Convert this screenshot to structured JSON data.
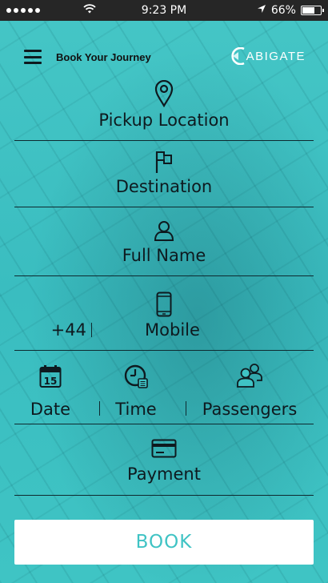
{
  "status_bar": {
    "time": "9:23 PM",
    "battery": "66%",
    "battery_level": 0.66,
    "signal_dots": 5
  },
  "header": {
    "title": "Book Your Journey",
    "logo_text": "ABIGATE"
  },
  "form": {
    "pickup": {
      "label": "Pickup Location",
      "icon": "location-pin-icon"
    },
    "destination": {
      "label": "Destination",
      "icon": "flag-icon"
    },
    "full_name": {
      "label": "Full Name",
      "icon": "user-icon"
    },
    "mobile": {
      "prefix": "+44",
      "label": "Mobile",
      "icon": "phone-icon"
    },
    "date": {
      "label": "Date",
      "icon": "calendar-icon",
      "icon_day": "15"
    },
    "time": {
      "label": "Time",
      "icon": "clock-icon"
    },
    "passengers": {
      "label": "Passengers",
      "icon": "people-icon"
    },
    "payment": {
      "label": "Payment",
      "icon": "credit-card-icon"
    }
  },
  "book_button": {
    "label": "BOOK"
  },
  "colors": {
    "accent": "#3fc3c4",
    "status_bar": "#262626",
    "text": "#0e1a1f",
    "button_bg": "#ffffff"
  }
}
